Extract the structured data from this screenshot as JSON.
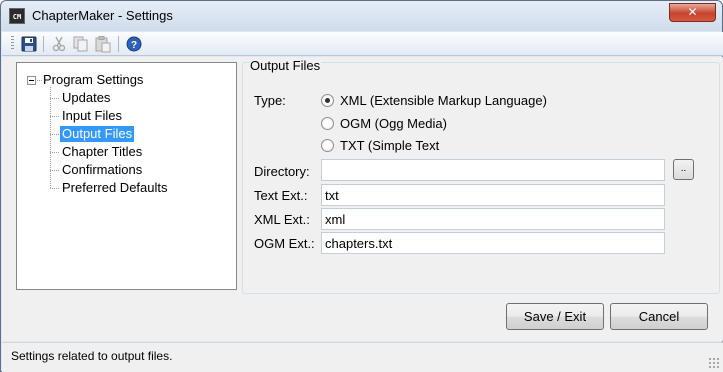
{
  "window": {
    "title": "ChapterMaker - Settings",
    "app_icon_text": "CM",
    "close_glyph": "✕"
  },
  "toolbar": {
    "buttons": [
      {
        "name": "save-icon",
        "enabled": true
      },
      {
        "name": "cut-icon",
        "enabled": false
      },
      {
        "name": "copy-icon",
        "enabled": false
      },
      {
        "name": "paste-icon",
        "enabled": false
      },
      {
        "name": "help-icon",
        "enabled": true
      }
    ]
  },
  "tree": {
    "root": "Program Settings",
    "items": [
      "Updates",
      "Input Files",
      "Output Files",
      "Chapter Titles",
      "Confirmations",
      "Preferred Defaults"
    ],
    "selected": "Output Files"
  },
  "output_files": {
    "group_title": "Output Files",
    "type_label": "Type:",
    "options": [
      {
        "label": "XML (Extensible Markup Language)",
        "checked": true
      },
      {
        "label": "OGM (Ogg Media)",
        "checked": false
      },
      {
        "label": "TXT (Simple Text",
        "checked": false
      }
    ],
    "directory_label": "Directory:",
    "directory_value": "",
    "browse_label": "..",
    "text_ext_label": "Text Ext.:",
    "text_ext_value": "txt",
    "xml_ext_label": "XML Ext.:",
    "xml_ext_value": "xml",
    "ogm_ext_label": "OGM Ext.:",
    "ogm_ext_value": "chapters.txt"
  },
  "buttons": {
    "save_exit": "Save / Exit",
    "cancel": "Cancel"
  },
  "status": {
    "text": "Settings related to output files."
  },
  "colors": {
    "selection": "#3399ff",
    "close_button": "#c7432d",
    "window_frame": "#dfe8f2"
  }
}
